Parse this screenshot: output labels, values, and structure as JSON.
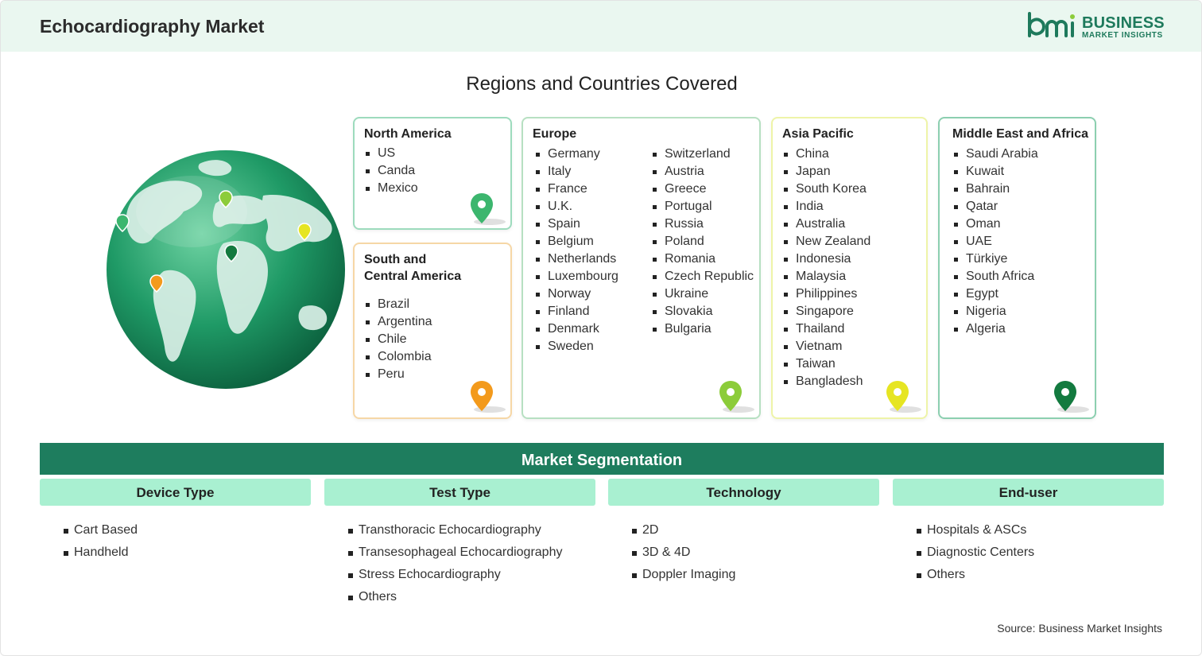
{
  "header": {
    "title": "Echocardiography Market"
  },
  "logo": {
    "line1": "BUSINESS",
    "line2": "MARKET INSIGHTS",
    "brand_color": "#1e7a5c"
  },
  "section_title": "Regions and Countries Covered",
  "regions": {
    "north_america": {
      "title": "North America",
      "countries": [
        "US",
        "Canda",
        "Mexico"
      ],
      "pin_color": "#3cb66e"
    },
    "south_central_america": {
      "title_line1": "South and",
      "title_line2": "Central America",
      "countries": [
        "Brazil",
        "Argentina",
        "Chile",
        "Colombia",
        "Peru"
      ],
      "pin_color": "#f39a1c"
    },
    "europe": {
      "title": "Europe",
      "col1": [
        "Germany",
        "Italy",
        "France",
        "U.K.",
        "Spain",
        "Belgium",
        "Netherlands",
        "Luxembourg",
        "Norway",
        "Finland",
        "Denmark",
        "Sweden"
      ],
      "col2": [
        "Switzerland",
        "Austria",
        "Greece",
        "Portugal",
        "Russia",
        "Poland",
        "Romania",
        "Czech Republic",
        "Ukraine",
        "Slovakia",
        "Bulgaria"
      ],
      "pin_color": "#8ccc3a"
    },
    "asia_pacific": {
      "title": "Asia Pacific",
      "countries": [
        "China",
        "Japan",
        "South Korea",
        "India",
        "Australia",
        "New Zealand",
        "Indonesia",
        "Malaysia",
        "Philippines",
        "Singapore",
        "Thailand",
        "Vietnam",
        "Taiwan",
        "Bangladesh"
      ],
      "pin_color": "#e6e522"
    },
    "middle_east_africa": {
      "title": "Middle East and Africa",
      "countries": [
        "Saudi Arabia",
        "Kuwait",
        "Bahrain",
        "Qatar",
        "Oman",
        "UAE",
        "Türkiye",
        "South Africa",
        "Egypt",
        "Nigeria",
        "Algeria"
      ],
      "pin_color": "#137a3f"
    }
  },
  "segmentation": {
    "title": "Market Segmentation",
    "columns": [
      {
        "heading": "Device Type",
        "items": [
          "Cart Based",
          "Handheld"
        ]
      },
      {
        "heading": "Test Type",
        "items": [
          "Transthoracic Echocardiography",
          "Transesophageal Echocardiography",
          "Stress Echocardiography",
          "Others"
        ]
      },
      {
        "heading": "Technology",
        "items": [
          "2D",
          "3D & 4D",
          "Doppler Imaging"
        ]
      },
      {
        "heading": "End-user",
        "items": [
          "Hospitals & ASCs",
          "Diagnostic Centers",
          "Others"
        ]
      }
    ]
  },
  "source": "Source: Business Market Insights",
  "colors": {
    "header_bg": "#eaf7f0",
    "segment_bar": "#1e7d5e",
    "segment_head": "#a9f0d1"
  }
}
